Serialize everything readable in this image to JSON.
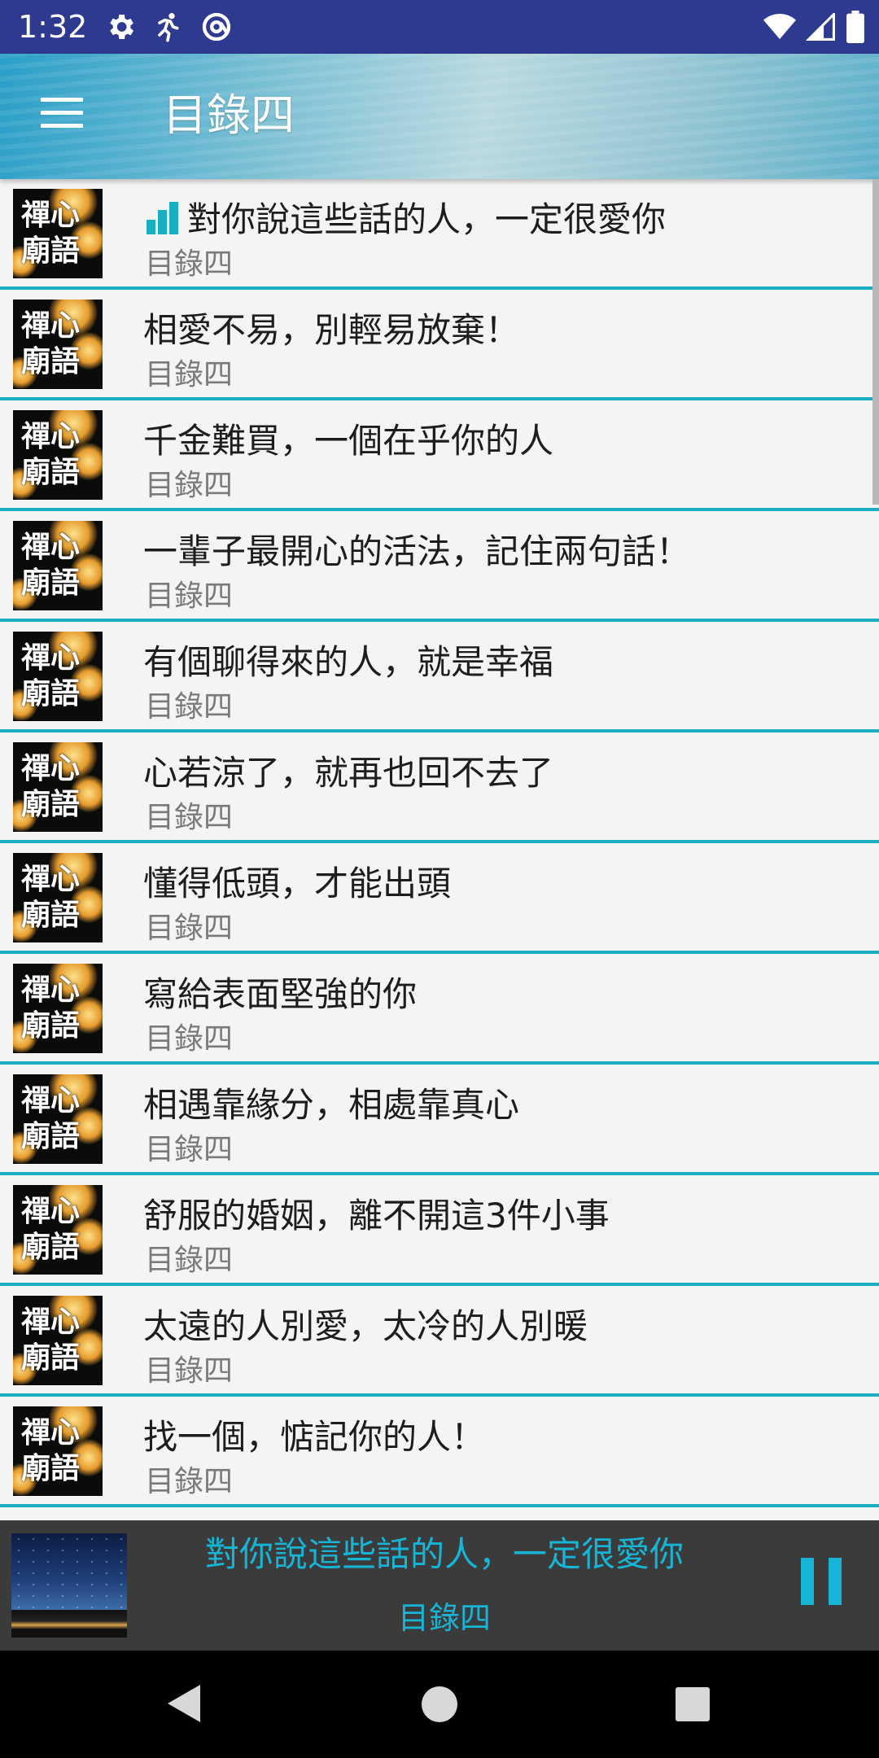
{
  "status_bar": {
    "time": "1:32",
    "left_icons": [
      "gear-icon",
      "running-person-icon",
      "at-sign-icon"
    ],
    "right_icons": [
      "wifi-icon",
      "cell-signal-icon",
      "battery-icon"
    ]
  },
  "header": {
    "title": "目錄四",
    "menu_icon": "hamburger-menu-icon"
  },
  "thumbnail": {
    "line1": "禪心",
    "line2": "廟語"
  },
  "list": {
    "items": [
      {
        "title": "對你說這些話的人，一定很愛你",
        "subtitle": "目錄四",
        "playing": true
      },
      {
        "title": "相愛不易，別輕易放棄！",
        "subtitle": "目錄四"
      },
      {
        "title": "千金難買，一個在乎你的人",
        "subtitle": "目錄四"
      },
      {
        "title": "一輩子最開心的活法，記住兩句話！",
        "subtitle": "目錄四"
      },
      {
        "title": "有個聊得來的人，就是幸福",
        "subtitle": "目錄四"
      },
      {
        "title": "心若涼了，就再也回不去了",
        "subtitle": "目錄四"
      },
      {
        "title": "懂得低頭，才能出頭",
        "subtitle": "目錄四"
      },
      {
        "title": "寫給表面堅強的你",
        "subtitle": "目錄四"
      },
      {
        "title": "相遇靠緣分，相處靠真心",
        "subtitle": "目錄四"
      },
      {
        "title": "舒服的婚姻，離不開這3件小事",
        "subtitle": "目錄四"
      },
      {
        "title": "太遠的人別愛，太冷的人別暖",
        "subtitle": "目錄四"
      },
      {
        "title": "找一個，惦記你的人！",
        "subtitle": "目錄四"
      }
    ]
  },
  "now_playing": {
    "title": "對你說這些話的人，一定很愛你",
    "subtitle": "目錄四",
    "control_icon": "pause-icon"
  },
  "nav_bar": {
    "icons": [
      "back-icon",
      "home-icon",
      "recents-icon"
    ]
  },
  "colors": {
    "status_bar": "#2e3a8f",
    "accent": "#1aaec3",
    "now_playing_bg": "#3b3b3b",
    "now_playing_text": "#16b5d6"
  }
}
